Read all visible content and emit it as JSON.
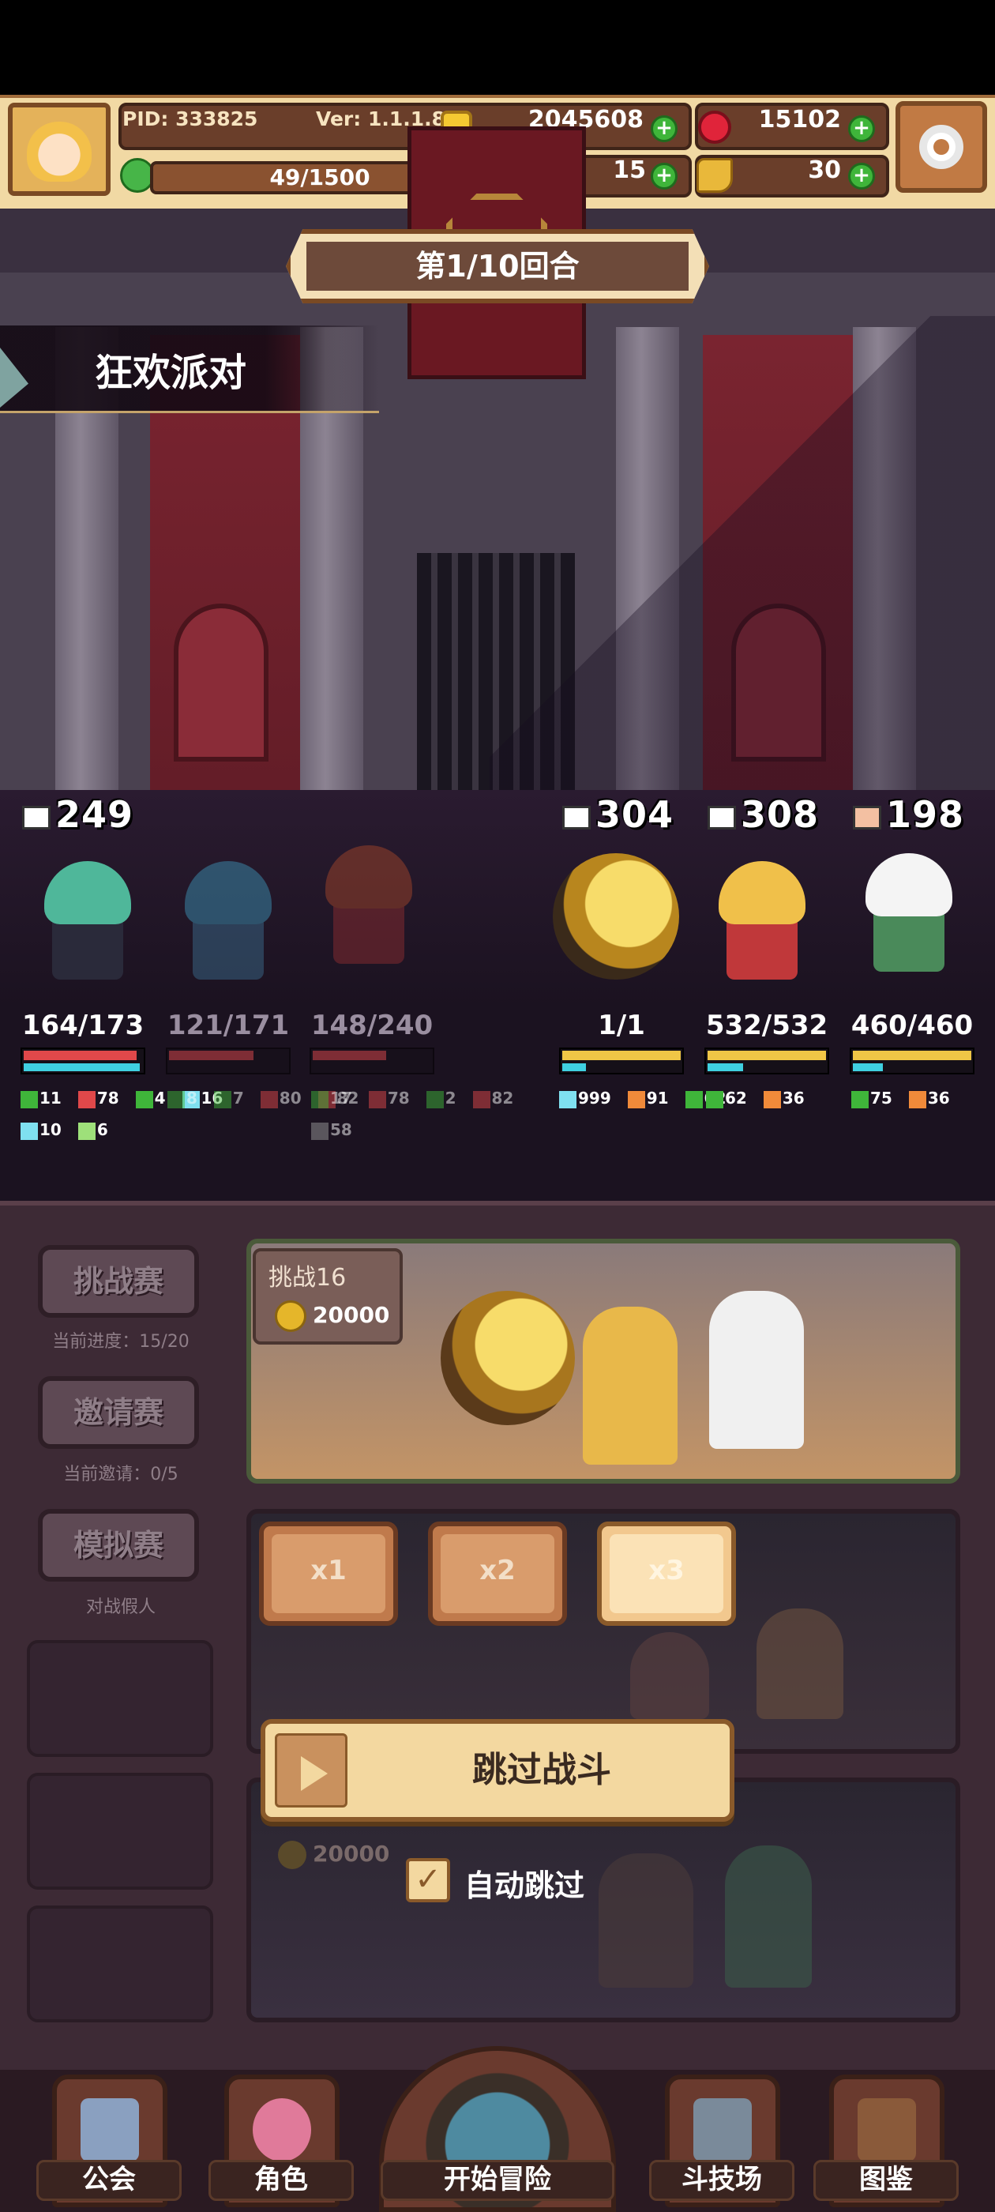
{
  "header": {
    "pid": "PID: 333825",
    "version": "Ver: 1.1.1.8",
    "gold": "2045608",
    "gems": "15102",
    "exp": "49/1500",
    "clover": "15",
    "keys": "30",
    "plus": "+"
  },
  "battle": {
    "round": "第1/10回合",
    "event": "狂欢派对",
    "left_team_power": "249",
    "right_powers": [
      "304",
      "308",
      "198"
    ],
    "left_units": [
      {
        "hp": "164/173",
        "hp_fill": 0.95,
        "mp_fill": 0.98,
        "stats": [
          "11",
          "78",
          "4",
          "16"
        ],
        "stats2": [
          "10",
          "6"
        ]
      },
      {
        "hp": "121/171",
        "hp_fill": 0.71,
        "mp_fill": 0.0,
        "stats": [
          "8",
          "7",
          "80",
          "82"
        ]
      },
      {
        "hp": "148/240",
        "hp_fill": 0.62,
        "mp_fill": 0.0,
        "stats": [
          "17",
          "78",
          "2",
          "82"
        ],
        "stats2": [
          "58"
        ]
      }
    ],
    "right_units": [
      {
        "hp": "1/1",
        "hp_fill": 1.0,
        "mp_fill": 0.2,
        "stats": [
          "999",
          "91",
          "62"
        ]
      },
      {
        "hp": "532/532",
        "hp_fill": 1.0,
        "mp_fill": 0.3,
        "stats": [
          "62",
          "36"
        ]
      },
      {
        "hp": "460/460",
        "hp_fill": 1.0,
        "mp_fill": 0.25,
        "stats": [
          "75",
          "36"
        ]
      }
    ],
    "colors": {
      "hp": "#e0484a",
      "hp_boss": "#f0c646",
      "mp": "#3fd0e0"
    }
  },
  "arena": {
    "side": [
      {
        "label": "挑战赛",
        "sub": "当前进度：15/20"
      },
      {
        "label": "邀请赛",
        "sub": "当前邀请：0/5"
      },
      {
        "label": "模拟赛",
        "sub": "对战假人"
      }
    ],
    "challenge_title": "挑战16",
    "challenge_cost": "20000",
    "speeds": [
      "x1",
      "x2",
      "x3"
    ],
    "selected_speed": "x3",
    "skip_label": "跳过战斗",
    "auto_skip_label": "自动跳过",
    "auto_skip_checked": true,
    "dim_cost": "20000"
  },
  "nav": {
    "items": [
      "公会",
      "角色",
      "开始冒险",
      "斗技场",
      "图鉴"
    ],
    "active": "斗技场"
  }
}
